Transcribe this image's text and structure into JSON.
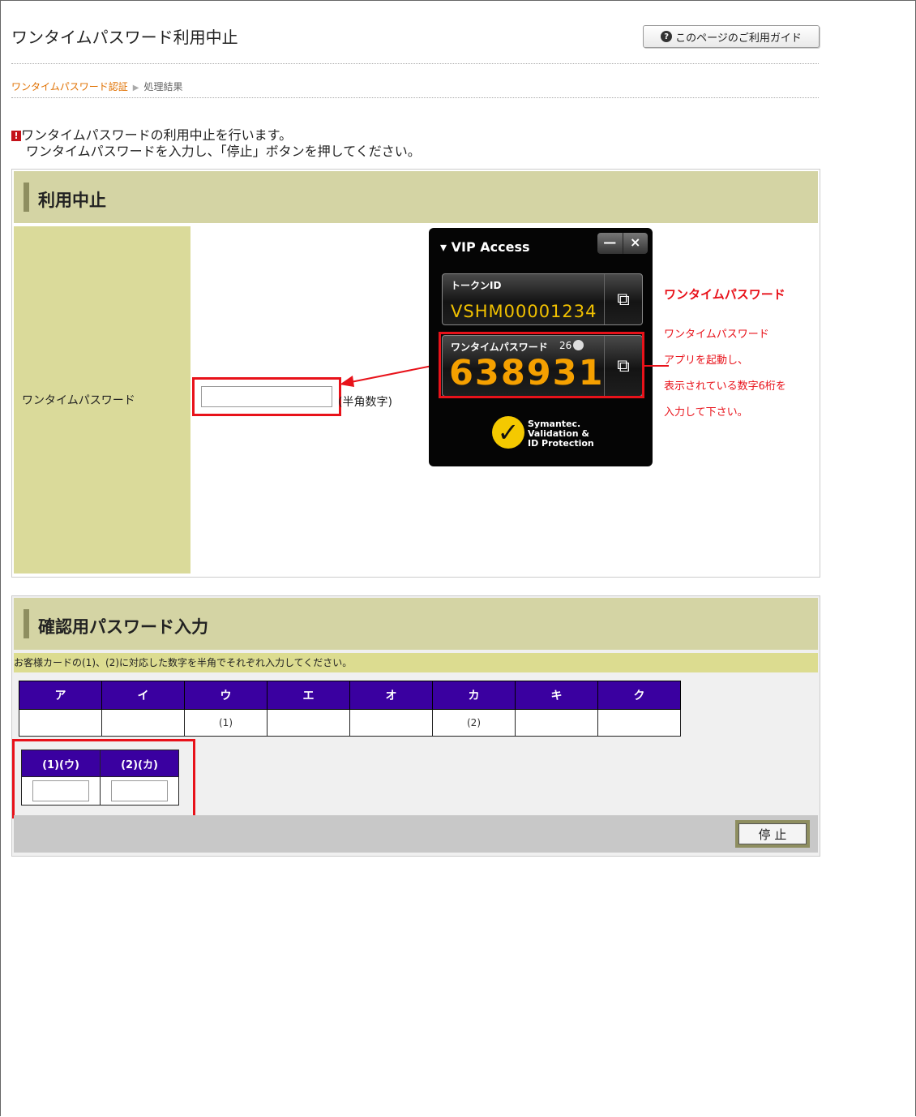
{
  "page": {
    "title": "ワンタイムパスワード利用中止",
    "guide_button": "このページのご利用ガイド",
    "guide_icon_glyph": "?"
  },
  "breadcrumb": {
    "current": "ワンタイムパスワード認証",
    "separator": "▶",
    "next": "処理結果"
  },
  "notice": {
    "mark": "!",
    "line1": "ワンタイムパスワードの利用中止を行います。",
    "line2": "ワンタイムパスワードを入力し、「停止」ボタンを押してください。"
  },
  "section1": {
    "title": "利用中止",
    "field_label": "ワンタイムパスワード",
    "input_value": "",
    "input_hint": "(半角数字)"
  },
  "vip_widget": {
    "title": "VIP Access",
    "minimize": "—",
    "close": "×",
    "token_label": "トークンID",
    "token_value": "VSHM00001234",
    "otp_label": "ワンタイムパスワード",
    "otp_timer": "26",
    "otp_code": "638931",
    "logo_line1": "Symantec.",
    "logo_line2": "Validation &",
    "logo_line3": "ID Protection"
  },
  "callout": {
    "heading": "ワンタイムパスワード",
    "line1": "ワンタイムパスワード",
    "line2": "アプリを起動し、",
    "line3": "表示されている数字6桁を",
    "line4": "入力して下さい。"
  },
  "section2": {
    "title": "確認用パスワード入力",
    "instruction": "お客様カードの(1)、(2)に対応した数字を半角でそれぞれ入力してください。",
    "grid_headers": [
      "ア",
      "イ",
      "ウ",
      "エ",
      "オ",
      "カ",
      "キ",
      "ク"
    ],
    "grid_values": [
      "",
      "",
      "(1)",
      "",
      "",
      "(2)",
      "",
      ""
    ],
    "pw_headers": [
      "(1)(ウ)",
      "(2)(カ)"
    ],
    "pw_values": [
      "",
      ""
    ],
    "stop_button": "停 止"
  },
  "colors": {
    "accent_red": "#e8121a",
    "header_olive": "#d4d4a4",
    "grid_header": "#3a00a0",
    "otp_orange": "#f5a000",
    "breadcrumb_orange": "#e07000"
  }
}
